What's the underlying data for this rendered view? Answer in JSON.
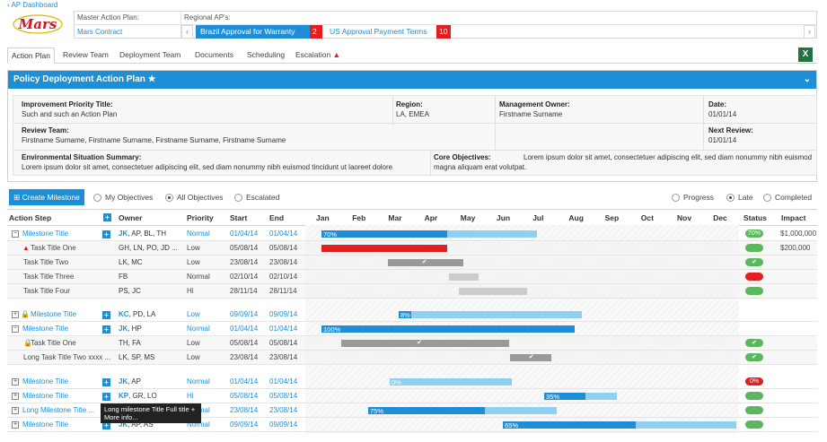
{
  "nav": {
    "back": "‹ AP Dashboard"
  },
  "brand": {
    "logo_text": "Mars"
  },
  "header": {
    "master_label": "Master Action Plan:",
    "master_value": "Mars Contract",
    "regional_label": "Regional AP's:",
    "regional": [
      {
        "label": "Brazil Approval for Warranty",
        "count": "2"
      },
      {
        "label": "US Approval Payment Terms",
        "count": "10"
      }
    ]
  },
  "tabs": [
    "Action Plan",
    "Review Team",
    "Deployment Team",
    "Documents",
    "Scheduling",
    "Escalation"
  ],
  "panel": {
    "title": "Policy Deployment Action Plan",
    "improvement_label": "Improvement Priority Title:",
    "improvement_value": "Such and such an Action Plan",
    "region_label": "Region:",
    "region_value": "LA, EMEA",
    "mgmt_label": "Management Owner:",
    "mgmt_value": "Firstname Surname",
    "date_label": "Date:",
    "date_value": "01/01/14",
    "review_label": "Review Team:",
    "review_value": "Firstname Surname, Firstname Surname, Firstname Surname, Firstname Surname",
    "next_label": "Next Review:",
    "next_value": "01/01/14",
    "env_label": "Environmental Situation Summary:",
    "env_value": "Lorem ipsum dolor sit amet, consectetuer adipiscing elit, sed diam nonummy nibh euismod tincidunt ut laoreet dolore",
    "core_label": "Core Objectives:",
    "core_value1": " Lorem ipsum dolor sit amet, consectetuer adipiscing elit, sed diam nonummy nibh euismod",
    "core_value2": "magna aliquam erat volutpat."
  },
  "toolbar": {
    "create": "Create Milestone",
    "filters": [
      "My Objectives",
      "All Objectives",
      "Escalated"
    ],
    "views": [
      "Progress",
      "Late",
      "Completed"
    ]
  },
  "table": {
    "headers": {
      "step": "Action Step",
      "owner": "Owner",
      "priority": "Priority",
      "start": "Start",
      "end": "End",
      "status": "Status",
      "impact": "Impact"
    },
    "months": [
      "Jan",
      "Feb",
      "Mar",
      "Apr",
      "May",
      "Jun",
      "Jul",
      "Aug",
      "Sep",
      "Oct",
      "Nov",
      "Dec"
    ]
  },
  "rows": [
    {
      "step": "Milestone Title",
      "owner_b": "JK",
      "owner": ", AP, BL, TH",
      "priority": "Normal",
      "start": "01/04/14",
      "end": "01/04/14",
      "bar_start": 0.0,
      "bar_end": 1.0,
      "bar_done": 0.7,
      "pct": "70%",
      "status": "70%",
      "status_color": "#5cb85c",
      "impact": "$1,000,000"
    },
    {
      "step": "Task Title One",
      "owner": "GH, LN, PO, JD ...",
      "priority": "Low",
      "start": "05/08/14",
      "end": "05/08/14",
      "status_color": "#5cb85c",
      "impact": "$200,000"
    },
    {
      "step": "Task Title Two",
      "owner": "LK, MC",
      "priority": "Low",
      "start": "23/08/14",
      "end": "23/08/14",
      "status": "✔",
      "status_color": "#5cb85c"
    },
    {
      "step": "Task Title Three",
      "owner": "FB",
      "priority": "Normal",
      "start": "02/10/14",
      "end": "02/10/14",
      "status_color": "#e02020"
    },
    {
      "step": "Task Title Four",
      "owner": "PS, JC",
      "priority": "Hi",
      "start": "28/11/14",
      "end": "28/11/14",
      "status_color": "#5cb85c"
    },
    {
      "step": "Milestone Title",
      "owner_b": "KC",
      "owner": ", PD, LA",
      "priority": "Low",
      "start": "09/09/14",
      "end": "09/09/14",
      "pct": "8%"
    },
    {
      "step": "Milestone Title",
      "owner_b": "JK",
      "owner": ", HP",
      "priority": "Normal",
      "start": "01/04/14",
      "end": "01/04/14",
      "pct": "100%"
    },
    {
      "step": "Task Title One",
      "owner": "TH, FA",
      "priority": "Low",
      "start": "05/08/14",
      "end": "05/08/14",
      "status": "✔",
      "status_color": "#5cb85c"
    },
    {
      "step": "Long Task Title Two xxxx ...",
      "owner": "LK, SP, MS",
      "priority": "Low",
      "start": "23/08/14",
      "end": "23/08/14",
      "status": "✔",
      "status_color": "#5cb85c"
    },
    {
      "step": "Milestone Title",
      "owner_b": "JK",
      "owner": ", AP",
      "priority": "Normal",
      "start": "01/04/14",
      "end": "01/04/14",
      "pct": "0%",
      "status": "0%",
      "status_color": "#e02020"
    },
    {
      "step": "Milestone Title",
      "owner_b": "KP",
      "owner": ", GR, LO",
      "priority": "Hi",
      "start": "05/08/14",
      "end": "05/08/14",
      "pct": "35%",
      "status_color": "#5cb85c"
    },
    {
      "step": "Long Milestone Title ...",
      "owner": "",
      "priority": "Normal",
      "start": "23/08/14",
      "end": "23/08/14",
      "pct": "75%",
      "status_color": "#5cb85c"
    },
    {
      "step": "Milestone Title",
      "owner_b": "JK",
      "owner": ", AP, AS",
      "priority": "Normal",
      "start": "09/09/14",
      "end": "09/09/14",
      "pct": "65%",
      "status_color": "#5cb85c"
    }
  ],
  "tooltip": "Long milestone Title Full title + More info..."
}
